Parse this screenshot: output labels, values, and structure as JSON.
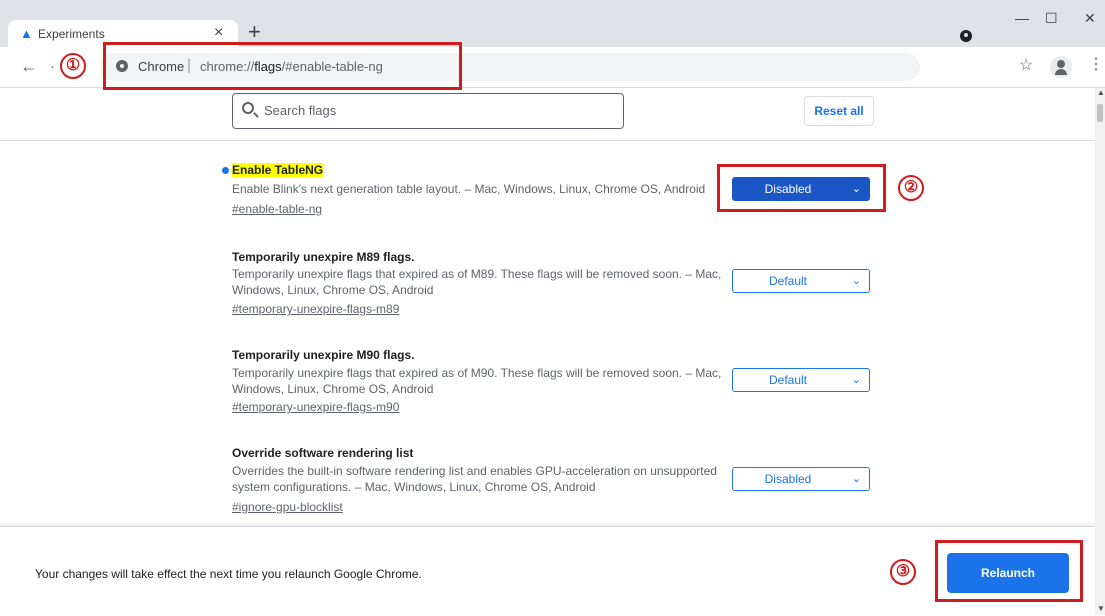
{
  "browser": {
    "tab_title": "Experiments",
    "tab_icon": "flask-icon",
    "close_tab": "×",
    "new_tab": "+",
    "window_controls": {
      "minimize": "—",
      "maximize": "☐",
      "close": "✕"
    },
    "back": "←",
    "forward": "·",
    "url_prefix": "Chrome",
    "url_separator": "|",
    "url_scheme": "chrome://",
    "url_host": "flags",
    "url_rest": "/#enable-table-ng",
    "bookmark_star": "☆",
    "menu": "⋮"
  },
  "search": {
    "placeholder": "Search flags"
  },
  "reset_all": "Reset all",
  "flags": [
    {
      "title": "Enable TableNG",
      "description": "Enable Blink's next generation table layout. – Mac, Windows, Linux, Chrome OS, Android",
      "link": "#enable-table-ng",
      "value": "Disabled",
      "modified": true
    },
    {
      "title": "Temporarily unexpire M89 flags.",
      "description": "Temporarily unexpire flags that expired as of M89. These flags will be removed soon. – Mac, Windows, Linux, Chrome OS, Android",
      "link": "#temporary-unexpire-flags-m89",
      "value": "Default",
      "modified": false
    },
    {
      "title": "Temporarily unexpire M90 flags.",
      "description": "Temporarily unexpire flags that expired as of M90. These flags will be removed soon. – Mac, Windows, Linux, Chrome OS, Android",
      "link": "#temporary-unexpire-flags-m90",
      "value": "Default",
      "modified": false
    },
    {
      "title": "Override software rendering list",
      "description": "Overrides the built-in software rendering list and enables GPU-acceleration on unsupported system configurations. – Mac, Windows, Linux, Chrome OS, Android",
      "link": "#ignore-gpu-blocklist",
      "value": "Disabled",
      "modified": false
    }
  ],
  "select_chevron": "⌄",
  "footer": {
    "message": "Your changes will take effect the next time you relaunch Google Chrome.",
    "relaunch": "Relaunch"
  },
  "annotations": [
    "①",
    "②",
    "③"
  ],
  "colors": {
    "accent": "#1a73e8",
    "annotation": "#d01c1c",
    "highlight": "#ffff00"
  }
}
